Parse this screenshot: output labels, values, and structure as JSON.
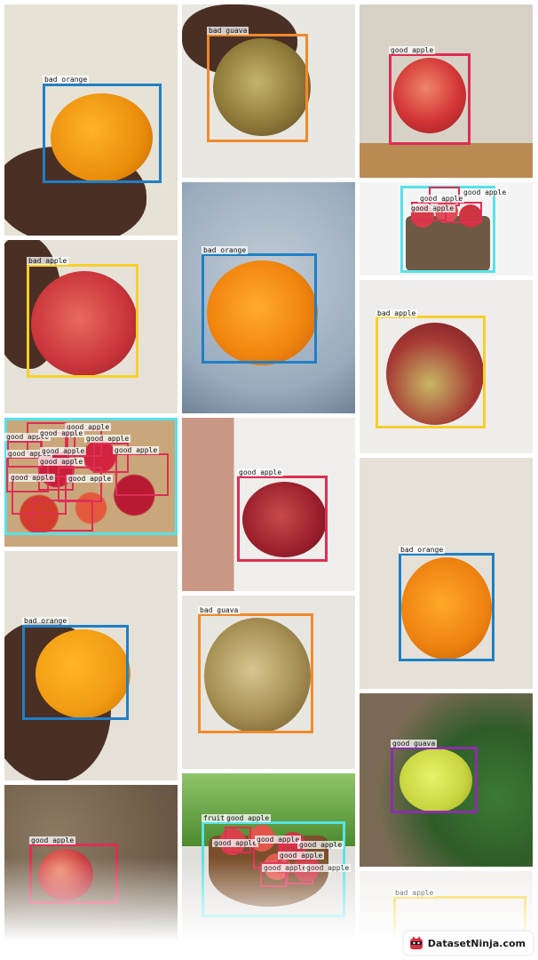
{
  "tiles": [
    {
      "labels": [
        "bad orange"
      ]
    },
    {
      "labels": [
        "bad guava"
      ]
    },
    {
      "labels": [
        "good apple"
      ]
    },
    {
      "labels": [
        "bad apple"
      ]
    },
    {
      "labels": [
        "bad orange"
      ]
    },
    {
      "labels": [
        "good apple",
        "good apple",
        "good apple"
      ]
    },
    {
      "labels": [
        "bad apple"
      ]
    },
    {
      "labels": [
        "good apple",
        "good apple",
        "good apple",
        "good apple",
        "good apple",
        "good apple",
        "good apple",
        "good apple",
        "good apple",
        "good apple"
      ]
    },
    {
      "labels": [
        "good apple"
      ]
    },
    {
      "labels": [
        "bad orange"
      ]
    },
    {
      "labels": [
        "bad orange"
      ]
    },
    {
      "labels": [
        "bad guava"
      ]
    },
    {
      "labels": [
        "good guava"
      ]
    },
    {
      "labels": [
        "good apple"
      ]
    },
    {
      "labels": [
        "fruit",
        "good apple",
        "good apple",
        "good apple",
        "good apple",
        "good apple",
        "good apple",
        "good apple"
      ]
    },
    {
      "labels": [
        "bad apple"
      ]
    }
  ],
  "box_colors": {
    "bad_orange": "#1f7fc6",
    "bad_guava": "#f08a2c",
    "good_apple": "#dc2f55",
    "bad_apple": "#f6cf2a",
    "good_guava": "#8b2fa8",
    "fruit": "#55e3ea"
  },
  "watermark": {
    "text": "DatasetNinja.com",
    "icon": "ninja-logo-icon"
  }
}
